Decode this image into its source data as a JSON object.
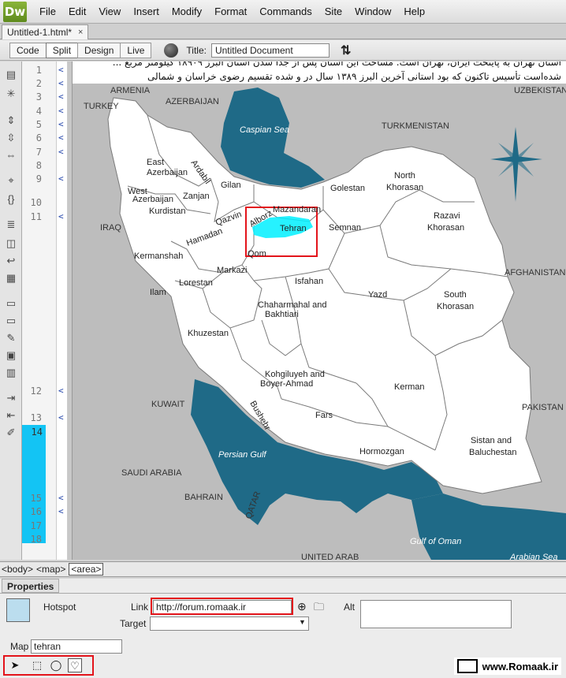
{
  "app": {
    "logo": "Dw"
  },
  "menu": [
    "File",
    "Edit",
    "View",
    "Insert",
    "Modify",
    "Format",
    "Commands",
    "Site",
    "Window",
    "Help"
  ],
  "document_tab": {
    "label": "Untitled-1.html*",
    "close": "×"
  },
  "toolbar": {
    "views": [
      "Code",
      "Split",
      "Design",
      "Live"
    ],
    "active_view": "Split",
    "title_label": "Title:",
    "title_value": "Untitled Document"
  },
  "line_numbers_top": [
    "1",
    "2",
    "3",
    "4",
    "5",
    "6",
    "7",
    "8",
    "9",
    "10",
    "11"
  ],
  "line_numbers_bottom": [
    "12",
    "13"
  ],
  "current_line": "14",
  "line_numbers_end": [
    "15",
    "16",
    "17",
    "18"
  ],
  "design_text": [
    "استان تهران به پایتخت ایران، تهران است. مساحت این استان پس از جدا شدن استان البرز ۱۸۹۰۹ کیلومتر مربع ...",
    "شده‌است تأسیس تاکنون که بود استانی آخرین البرز ۱۳۸۹ سال در و شده تقسیم رضوی خراسان و شمالی"
  ],
  "map": {
    "countries": [
      "ARMENIA",
      "AZERBAIJAN",
      "TURKEY",
      "UZBEKISTAN",
      "TURKMENISTAN",
      "IRAQ",
      "AFGHANISTAN",
      "KUWAIT",
      "SAUDI ARABIA",
      "PAKISTAN",
      "BAHRAIN",
      "QATAR",
      "UNITED ARAB"
    ],
    "water": [
      "Caspian Sea",
      "Persian Gulf",
      "Gulf of Oman",
      "Arabian Sea"
    ],
    "provinces": [
      "East Azerbaijan",
      "West Azerbaijan",
      "Ardabil",
      "Gilan",
      "Zanjan",
      "Kurdistan",
      "Qazvin",
      "Golestan",
      "North Khorasan",
      "Mazandaran",
      "Razavi Khorasan",
      "Alborz",
      "Tehran",
      "Semnan",
      "Hamadan",
      "Kermanshah",
      "Qom",
      "Markazi",
      "Lorestan",
      "Isfahan",
      "Ilam",
      "Yazd",
      "South Khorasan",
      "Chaharmahal and Bakhtiari",
      "Khuzestan",
      "Kohgiluyeh and Boyer-Ahmad",
      "Kerman",
      "Bushehr",
      "Fars",
      "Hormozgan",
      "Sistan and Baluchestan"
    ],
    "colors": {
      "water": "#1f6a87",
      "land": "#ffffff",
      "neighbor": "#bdbdbd",
      "hotspot": "#00f0ff",
      "highlight": "#e3141b"
    }
  },
  "statusbar": {
    "tags": [
      "<body>",
      "<map>",
      "<area>"
    ]
  },
  "properties": {
    "tab": "Properties",
    "type": "Hotspot",
    "link_label": "Link",
    "link_value": "http://forum.romaak.ir",
    "target_label": "Target",
    "target_value": "",
    "alt_label": "Alt",
    "alt_value": "",
    "map_label": "Map",
    "map_value": "tehran"
  },
  "watermark": "www.Romaak.ir"
}
